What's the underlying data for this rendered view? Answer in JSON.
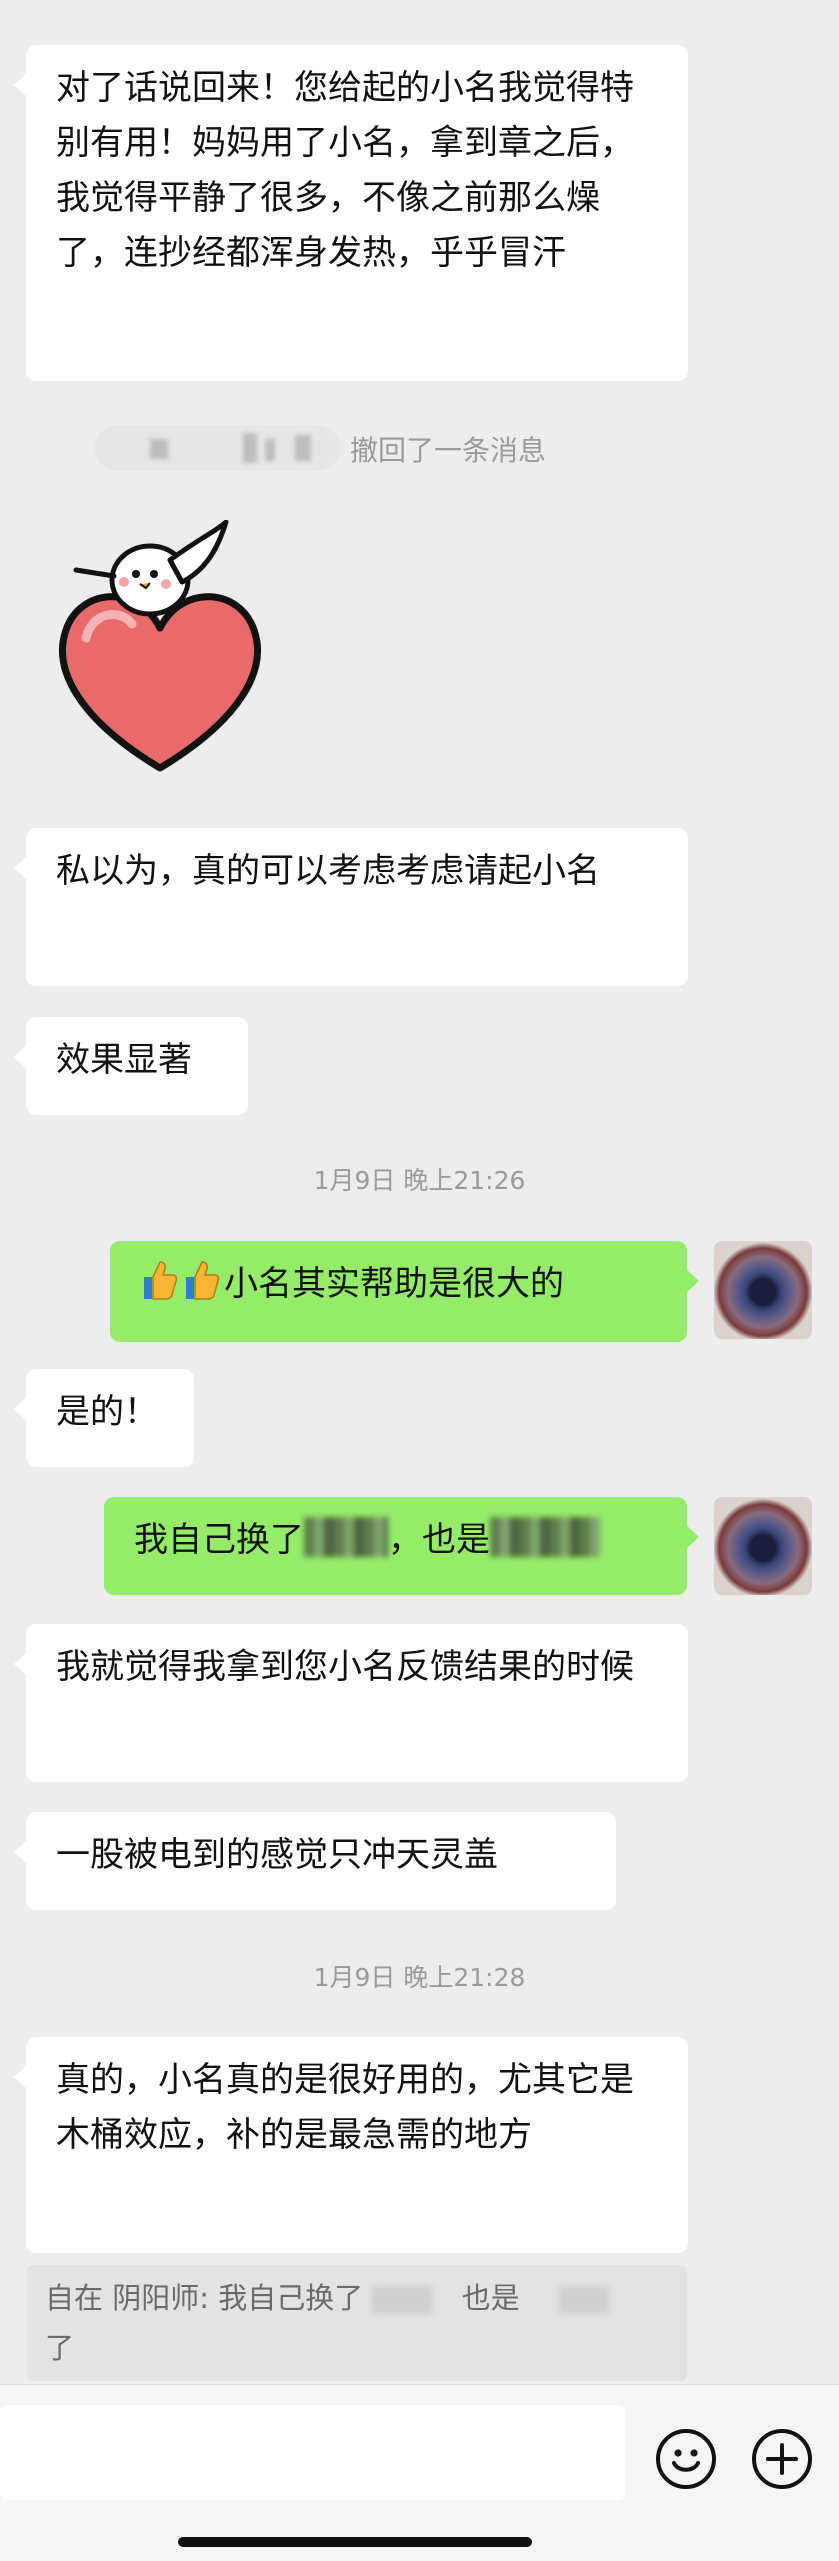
{
  "messages": {
    "m1": "对了话说回来！您给起的小名我觉得特别有用！妈妈用了小名，拿到章之后，我觉得平静了很多，不像之前那么燥了，连抄经都浑身发热，乎乎冒汗",
    "recall_text": "撤回了一条消息",
    "m2": "私以为，真的可以考虑考虑请起小名",
    "m3": "效果显著",
    "ts1": "1月9日 晚上21:26",
    "mine1_text": "小名其实帮助是很大的",
    "m4": "是的！",
    "mine2_a": "我自己换了",
    "mine2_b": "，也是",
    "m5": "我就觉得我拿到您小名反馈结果的时候",
    "m6": "一股被电到的感觉只冲天灵盖",
    "ts2": "1月9日 晚上21:28",
    "m7": "真的，小名真的是很好用的，尤其它是木桶效应，补的是最急需的地方"
  },
  "quote": {
    "sender": "自在 阴阳师:",
    "text_a": "我自己换了",
    "text_b": "也是",
    "text_c": "了"
  },
  "icons": {
    "emoji_button": "smiley-face-icon",
    "plus_button": "plus-icon",
    "thumbs": "thumbs-up-icon"
  },
  "colors": {
    "background": "#ededed",
    "incoming_bubble": "#ffffff",
    "outgoing_bubble": "#95ec69",
    "timestamp": "#9a9a9a"
  }
}
